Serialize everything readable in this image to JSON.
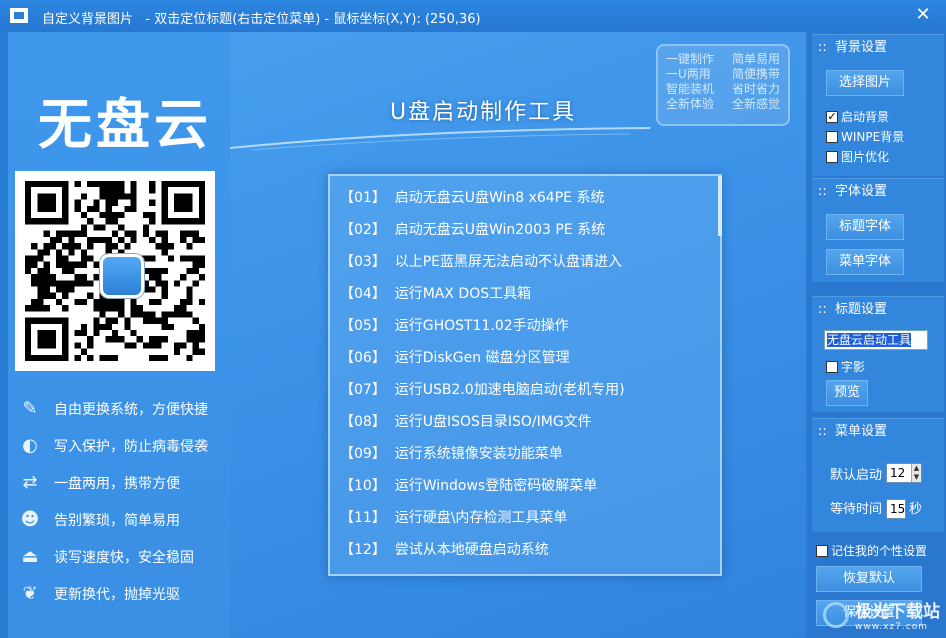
{
  "window": {
    "title": "自定义背景图片   - 双击定位标题(右击定位菜单) - 鼠标坐标(X,Y): (250,36)",
    "close_glyph": "✕"
  },
  "preview": {
    "logo": "无盘云",
    "brand_title": "U盘启动制作工具",
    "slogans": [
      [
        "一键制作",
        "简单易用"
      ],
      [
        "一U两用",
        "简便携带"
      ],
      [
        "智能装机",
        "省时省力"
      ],
      [
        "全新体验",
        "全新感觉"
      ]
    ],
    "features": [
      {
        "icon": "pencil-icon",
        "glyph": "✎",
        "text": "自由更换系统，方便快捷"
      },
      {
        "icon": "shield-icon",
        "glyph": "◐",
        "text": "写入保护，防止病毒侵袭"
      },
      {
        "icon": "shuffle-icon",
        "glyph": "⇄",
        "text": "一盘两用，携带方便"
      },
      {
        "icon": "users-icon",
        "glyph": "☻",
        "text": "告别繁琐，简单易用"
      },
      {
        "icon": "drive-icon",
        "glyph": "⏏",
        "text": "读写速度快，安全稳固"
      },
      {
        "icon": "leaf-icon",
        "glyph": "❦",
        "text": "更新换代，抛掉光驱"
      }
    ],
    "menu": [
      "【01】  启动无盘云U盘Win8 x64PE 系统",
      "【02】  启动无盘云U盘Win2003 PE 系统",
      "【03】  以上PE蓝黑屏无法启动不认盘请进入",
      "【04】  运行MAX DOS工具箱",
      "【05】  运行GHOST11.02手动操作",
      "【06】  运行DiskGen 磁盘分区管理",
      "【07】  运行USB2.0加速电脑启动(老机专用)",
      "【08】  运行U盘ISOS目录ISO/IMG文件",
      "【09】  运行系统镜像安装功能菜单",
      "【10】  运行Windows登陆密码破解菜单",
      "【11】  运行硬盘\\内存检测工具菜单",
      "【12】  尝试从本地硬盘启动系统"
    ]
  },
  "settings": {
    "background": {
      "title": "::  背景设置",
      "choose_button": "选择图片",
      "enable_bg": {
        "label": "启动背景",
        "checked": true
      },
      "winpe_bg": {
        "label": "WINPE背景",
        "checked": false
      },
      "optimize": {
        "label": "图片优化",
        "checked": false
      }
    },
    "font": {
      "title": "::  字体设置",
      "title_font_button": "标题字体",
      "menu_font_button": "菜单字体"
    },
    "heading": {
      "title": "::  标题设置",
      "input_value": "无盘云启动工具",
      "shadow": {
        "label": "字影",
        "checked": false
      },
      "preview_button": "预览"
    },
    "menu": {
      "title": "::  菜单设置",
      "default_boot_label": "默认启动",
      "default_boot_value": "12",
      "wait_label": "等待时间",
      "wait_value": "15",
      "wait_unit": "秒"
    },
    "remember": {
      "label": "记住我的个性设置",
      "checked": false
    },
    "restore_button": "恢复默认",
    "save_button": "保存设置"
  },
  "watermark": {
    "text": "极光下载站",
    "sub": "www.xz7.com"
  }
}
